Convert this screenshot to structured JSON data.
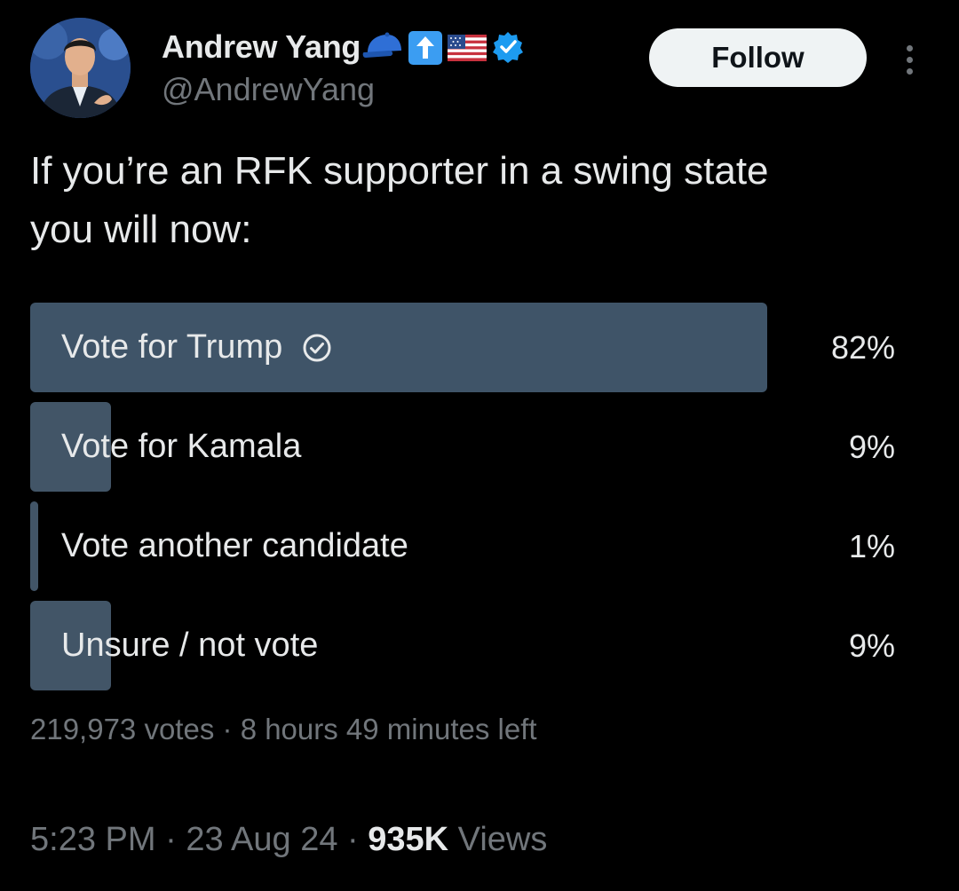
{
  "author": {
    "display_name": "Andrew Yang",
    "handle": "@AndrewYang",
    "emojis": [
      "blue-cap-icon",
      "up-arrow-icon",
      "us-flag-icon"
    ],
    "verified": true,
    "verified_color": "#1d9bf0"
  },
  "actions": {
    "follow_label": "Follow"
  },
  "tweet": {
    "text_line1": "If you’re an RFK supporter in a swing state",
    "text_line2": "you will now:"
  },
  "poll": {
    "options": [
      {
        "label": "Vote for Trump",
        "percent_text": "82%",
        "percent": 82,
        "winner": true
      },
      {
        "label": "Vote for Kamala",
        "percent_text": "9%",
        "percent": 9,
        "winner": false
      },
      {
        "label": "Vote another candidate",
        "percent_text": "1%",
        "percent": 1,
        "winner": false
      },
      {
        "label": "Unsure / not vote",
        "percent_text": "9%",
        "percent": 9,
        "winner": false
      }
    ],
    "votes": "219,973 votes",
    "separator": "·",
    "time_left": "8 hours 49 minutes left",
    "bar_color": "#425567"
  },
  "meta": {
    "time": "5:23 PM",
    "date": "23 Aug 24",
    "views_count": "935K",
    "views_label": "Views",
    "separator": "·"
  },
  "colors": {
    "background": "#000000",
    "text_primary": "#e7e9ea",
    "text_secondary": "#71767b"
  }
}
